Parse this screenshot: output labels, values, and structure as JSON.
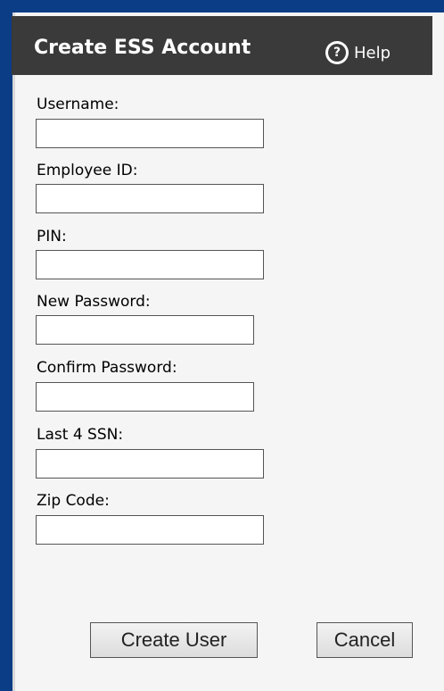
{
  "dialog": {
    "title": "Create ESS Account",
    "help_label": "Help",
    "help_icon_glyph": "?"
  },
  "fields": {
    "username": {
      "label": "Username:",
      "value": ""
    },
    "employee_id": {
      "label": "Employee ID:",
      "value": ""
    },
    "pin": {
      "label": "PIN:",
      "value": ""
    },
    "new_password": {
      "label": "New Password:",
      "value": ""
    },
    "confirm_password": {
      "label": "Confirm Password:",
      "value": ""
    },
    "last4_ssn": {
      "label": "Last 4 SSN:",
      "value": ""
    },
    "zip_code": {
      "label": "Zip Code:",
      "value": ""
    }
  },
  "buttons": {
    "create_user": "Create User",
    "cancel": "Cancel"
  },
  "colors": {
    "window_background": "#0b3c86",
    "titlebar": "#3a3a3a",
    "dialog_background": "#f5f5f5"
  },
  "icons": {
    "help": "help-icon"
  }
}
